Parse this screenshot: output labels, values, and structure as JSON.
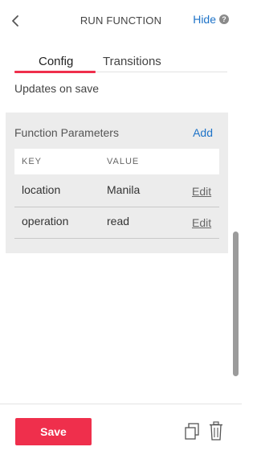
{
  "header": {
    "title": "RUN FUNCTION",
    "hide_label": "Hide",
    "help_glyph": "?",
    "back_icon": "chevron-left-icon"
  },
  "tabs": [
    {
      "label": "Config",
      "active": true
    },
    {
      "label": "Transitions",
      "active": false
    }
  ],
  "updates_note": "Updates on save",
  "params": {
    "title": "Function Parameters",
    "add_label": "Add",
    "columns": [
      "KEY",
      "VALUE"
    ],
    "rows": [
      {
        "key": "location",
        "value": "Manila",
        "action": "Edit"
      },
      {
        "key": "operation",
        "value": "read",
        "action": "Edit"
      }
    ]
  },
  "footer": {
    "save_label": "Save",
    "duplicate_icon": "duplicate-icon",
    "delete_icon": "trash-icon"
  },
  "colors": {
    "accent": "#ef2f4c",
    "link": "#1e73c8",
    "panel_bg": "#ececec"
  }
}
